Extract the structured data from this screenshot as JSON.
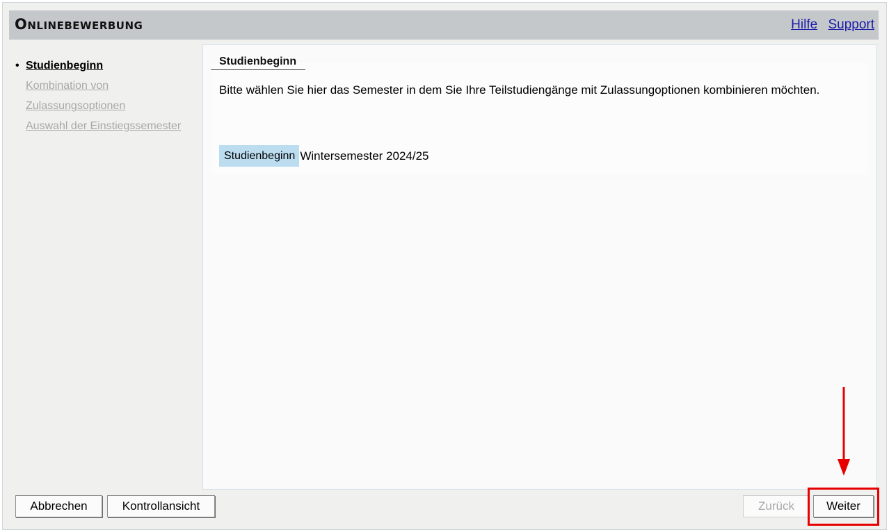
{
  "header": {
    "title": "Onlinebewerbung",
    "links": {
      "help": "Hilfe",
      "support": "Support"
    }
  },
  "sidebar": {
    "items": [
      {
        "label": "Studienbeginn",
        "state": "active"
      },
      {
        "label": "Kombination von",
        "state": "disabled"
      },
      {
        "label": "Zulassungsoptionen",
        "state": "disabled"
      },
      {
        "label": "Auswahl der Einstiegssemester",
        "state": "disabled"
      }
    ]
  },
  "main": {
    "section_title": "Studienbeginn",
    "description": "Bitte wählen Sie hier das Semester in dem Sie Ihre Teilstudiengänge mit Zulassungoptionen kombinieren möchten.",
    "field": {
      "label": "Studienbeginn",
      "value": "Wintersemester 2024/25"
    }
  },
  "footer": {
    "cancel": "Abbrechen",
    "control_view": "Kontrollansicht",
    "back": "Zurück",
    "next": "Weiter"
  },
  "colors": {
    "header_bg": "#c4c8cb",
    "field_label_bg": "#bcdcf0",
    "link": "#1a1aa6",
    "annotation": "#e60000"
  },
  "icons": {
    "annotation_arrow": "down-arrow-icon"
  }
}
